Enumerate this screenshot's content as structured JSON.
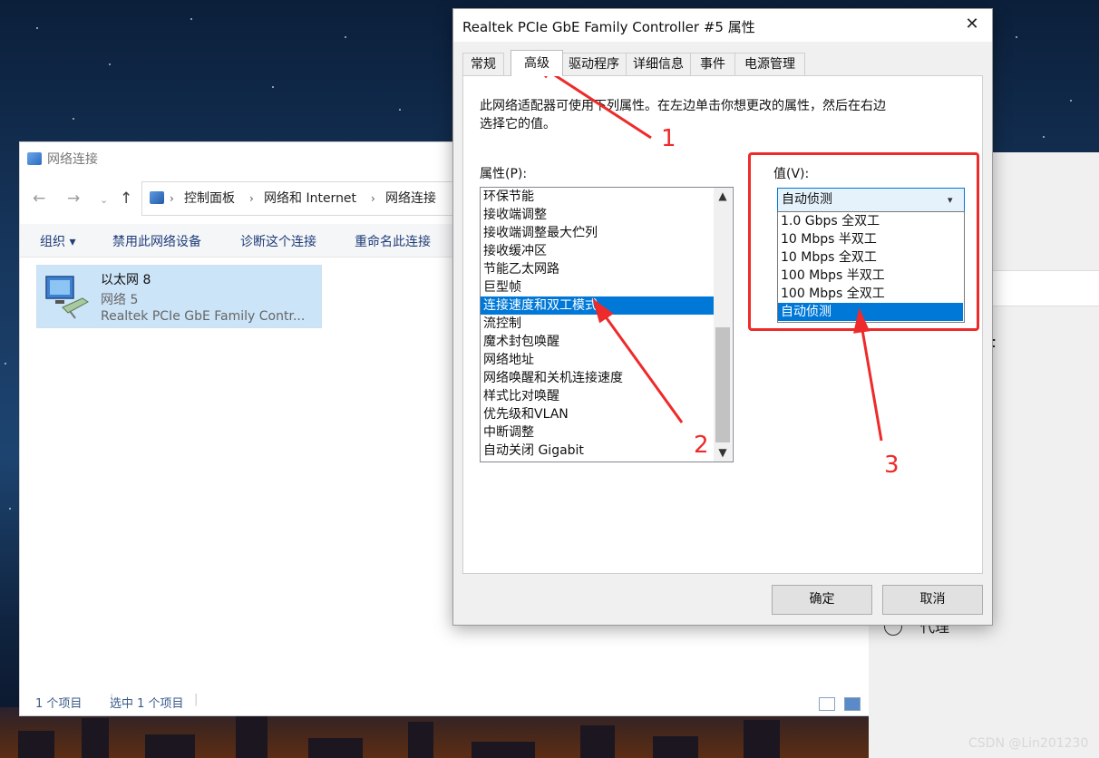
{
  "explorer": {
    "title": "网络连接",
    "breadcrumb": [
      "控制面板",
      "网络和 Internet",
      "网络连接"
    ],
    "commands": [
      "组织 ▾",
      "禁用此网络设备",
      "诊断这个连接",
      "重命名此连接"
    ],
    "adapter": {
      "name": "以太网 8",
      "network": "网络 5",
      "device": "Realtek PCIe GbE Family Contr..."
    },
    "status": {
      "items": "1 个项目",
      "selected": "选中 1 个项目"
    }
  },
  "right_panel": {
    "fragment": "t",
    "proxy_label": "代理"
  },
  "dialog": {
    "title": "Realtek PCIe GbE Family Controller #5 属性",
    "tabs": [
      "常规",
      "高级",
      "驱动程序",
      "详细信息",
      "事件",
      "电源管理"
    ],
    "active_tab": "高级",
    "description_line1": "此网络适配器可使用下列属性。在左边单击你想更改的属性，然后在右边",
    "description_line2": "选择它的值。",
    "property_label": "属性(P):",
    "value_label": "值(V):",
    "properties": [
      "环保节能",
      "接收端调整",
      "接收端调整最大伫列",
      "接收缓冲区",
      "节能乙太网路",
      "巨型帧",
      "连接速度和双工模式",
      "流控制",
      "魔术封包唤醒",
      "网络地址",
      "网络唤醒和关机连接速度",
      "样式比对唤醒",
      "优先级和VLAN",
      "中断调整",
      "自动关闭 Gigabit"
    ],
    "selected_property": "连接速度和双工模式",
    "combo_value": "自动侦测",
    "value_options": [
      "1.0 Gbps 全双工",
      "10 Mbps 半双工",
      "10 Mbps 全双工",
      "100 Mbps 半双工",
      "100 Mbps 全双工",
      "自动侦测"
    ],
    "selected_value": "自动侦测",
    "ok_label": "确定",
    "cancel_label": "取消",
    "close_glyph": "✕"
  },
  "annotations": {
    "labels": [
      "1",
      "2",
      "3"
    ],
    "color": "#ee2a2a"
  },
  "watermark": "CSDN @Lin201230",
  "colors": {
    "selection": "#0078d7",
    "adapter_selected": "#cce4f7"
  }
}
